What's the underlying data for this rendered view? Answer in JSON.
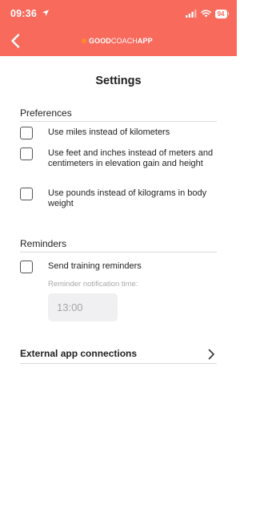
{
  "status_bar": {
    "time": "09:36",
    "battery": "94"
  },
  "header": {
    "logo_part1": "GOOD",
    "logo_part2": "COACH",
    "logo_part3": "APP",
    "background": "#f86a5c"
  },
  "page": {
    "title": "Settings"
  },
  "preferences": {
    "heading": "Preferences",
    "items": [
      {
        "label": "Use miles instead of kilometers",
        "checked": false
      },
      {
        "label": "Use feet and inches instead of meters and centimeters in elevation gain and height",
        "checked": false
      },
      {
        "label": "Use pounds instead of kilograms in body weight",
        "checked": false
      }
    ]
  },
  "reminders": {
    "heading": "Reminders",
    "send_label": "Send training reminders",
    "send_checked": false,
    "time_label": "Reminder notification time:",
    "time_value": "13:00"
  },
  "external": {
    "label": "External app connections"
  },
  "icons": [
    "location-arrow-icon",
    "signal-icon",
    "wifi-icon",
    "battery-icon",
    "back-chevron-icon",
    "chevron-right-icon"
  ]
}
